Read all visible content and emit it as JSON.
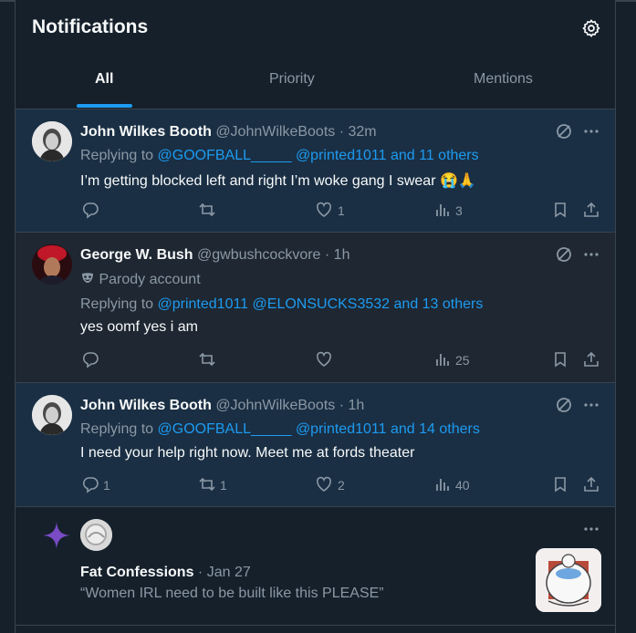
{
  "header": {
    "title": "Notifications"
  },
  "tabs": [
    {
      "label": "All"
    },
    {
      "label": "Priority"
    },
    {
      "label": "Mentions"
    }
  ],
  "notifications": [
    {
      "name": "John Wilkes Booth",
      "handle": "@JohnWilkeBoots",
      "time": "· 32m",
      "replying_prefix": "Replying to",
      "replying_user1": "@GOOFBALL_____",
      "replying_user2": "@printed1011",
      "replying_others": "and 11 others",
      "text": "I’m getting blocked left and right I’m woke gang I swear 😭🙏",
      "replies": "",
      "retweets": "",
      "likes": "1",
      "views": "3"
    },
    {
      "name": "George W. Bush",
      "handle": "@gwbushcockvore",
      "time": "· 1h",
      "parody_label": "Parody account",
      "replying_prefix": "Replying to",
      "replying_user1": "@printed1011",
      "replying_user2": "@ELONSUCKS3532",
      "replying_others": "and 13 others",
      "text": "yes oomf yes i am",
      "replies": "",
      "retweets": "",
      "likes": "",
      "views": "25"
    },
    {
      "name": "John Wilkes Booth",
      "handle": "@JohnWilkeBoots",
      "time": "· 1h",
      "replying_prefix": "Replying to",
      "replying_user1": "@GOOFBALL_____",
      "replying_user2": "@printed1011",
      "replying_others": "and 14 others",
      "text": "I need your help right now. Meet me at fords theater",
      "replies": "1",
      "retweets": "1",
      "likes": "2",
      "views": "40"
    },
    {
      "name": "Fat Confessions",
      "time": "· Jan 27",
      "text": "“Women IRL need to be built like this PLEASE”"
    }
  ],
  "colors": {
    "background": "#15202b",
    "unread": "#1a2f44",
    "accent": "#1d9bf0",
    "secondary_text": "#8b98a5",
    "border": "#38444d",
    "spark": "#794bc4"
  },
  "icons": [
    "gear-icon",
    "reply-icon",
    "retweet-icon",
    "like-icon",
    "views-icon",
    "bookmark-icon",
    "share-icon",
    "more-icon",
    "grok-icon",
    "mask-icon",
    "sparkle-icon"
  ]
}
